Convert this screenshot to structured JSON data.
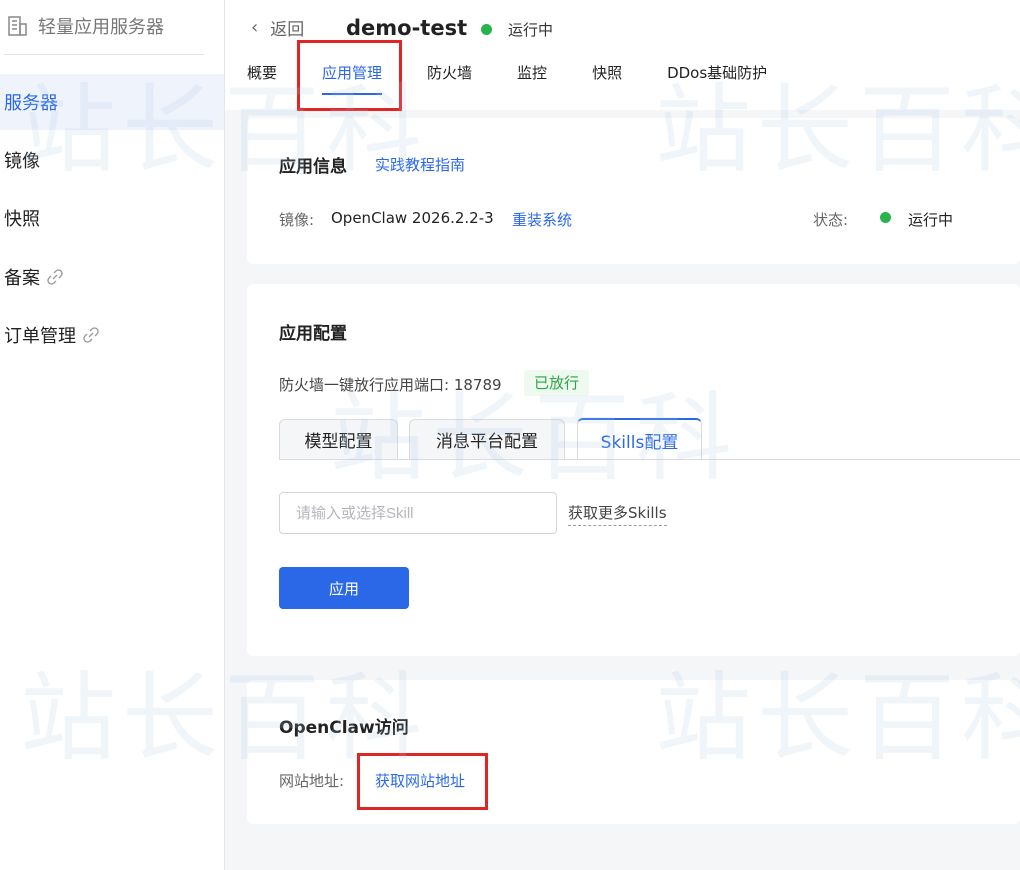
{
  "sidebar": {
    "title": "轻量应用服务器",
    "items": [
      {
        "label": "服务器",
        "active": true
      },
      {
        "label": "镜像"
      },
      {
        "label": "快照"
      },
      {
        "label": "备案",
        "link_icon": true
      },
      {
        "label": "订单管理",
        "link_icon": true
      }
    ]
  },
  "header": {
    "back_label": "返回",
    "instance_name": "demo-test",
    "status": "运行中",
    "status_color": "#28b34c",
    "tabs": [
      "概要",
      "应用管理",
      "防火墙",
      "监控",
      "快照",
      "DDos基础防护"
    ],
    "active_tab": "应用管理"
  },
  "app_info": {
    "title": "应用信息",
    "guide_link": "实践教程指南",
    "image_label": "镜像:",
    "image_value": "OpenClaw 2026.2.2-3",
    "reinstall_link": "重装系统",
    "status_label": "状态:",
    "status_value": "运行中"
  },
  "app_config": {
    "title": "应用配置",
    "firewall_text": "防火墙一键放行应用端口: 18789",
    "firewall_tag": "已放行",
    "subtabs": [
      "模型配置",
      "消息平台配置",
      "Skills配置"
    ],
    "active_subtab": "Skills配置",
    "skill_placeholder": "请输入或选择Skill",
    "more_skills_link": "获取更多Skills",
    "apply_button": "应用"
  },
  "access": {
    "title": "OpenClaw访问",
    "site_label": "网站地址:",
    "site_link": "获取网站地址"
  },
  "watermark": "站长百科",
  "colors": {
    "accent": "#2b68e8",
    "highlight_box": "#e02525",
    "success": "#28a745"
  }
}
